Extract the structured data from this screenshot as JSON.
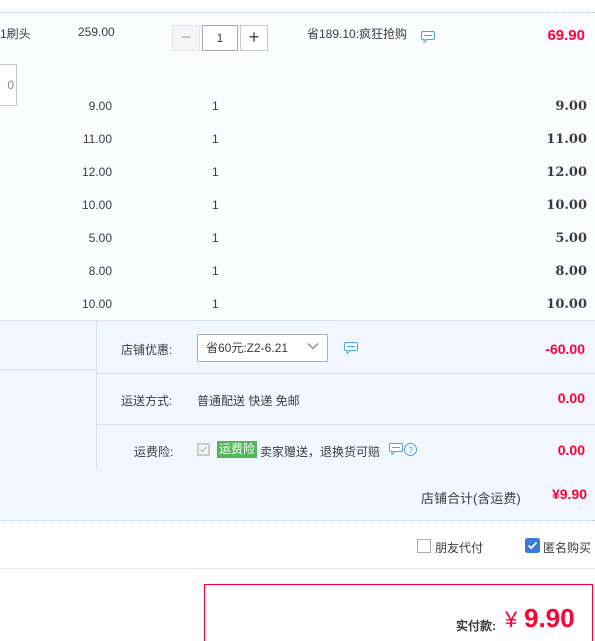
{
  "item": {
    "name": "1刷头",
    "price": "259.00",
    "qty_minus": "−",
    "qty": "1",
    "qty_plus": "+",
    "promo": "省189.10:疯狂抢购",
    "total": "69.90"
  },
  "rows": [
    {
      "price": "9.00",
      "qty": "1",
      "total": "9.00"
    },
    {
      "price": "11.00",
      "qty": "1",
      "total": "11.00"
    },
    {
      "price": "12.00",
      "qty": "1",
      "total": "12.00"
    },
    {
      "price": "10.00",
      "qty": "1",
      "total": "10.00"
    },
    {
      "price": "5.00",
      "qty": "1",
      "total": "5.00"
    },
    {
      "price": "8.00",
      "qty": "1",
      "total": "8.00"
    },
    {
      "price": "10.00",
      "qty": "1",
      "total": "10.00"
    }
  ],
  "shop": {
    "left_input_value": "0",
    "discount_label": "店铺优惠:",
    "discount_select": "省60元:Z2-6.21",
    "discount_value": "-60.00",
    "shipping_label": "运送方式:",
    "shipping_value_text": "普通配送 快递 免邮",
    "shipping_value": "0.00",
    "insurance_label": "运费险:",
    "insurance_tag": "运费险",
    "insurance_text": "卖家赠送，退换货可赔",
    "insurance_value": "0.00",
    "total_label": "店铺合计(含运费)",
    "total_value": "¥9.90"
  },
  "options": {
    "friend_pay": "朋友代付",
    "anonymous": "匿名购买"
  },
  "payment": {
    "label": "实付款:",
    "currency": "¥",
    "amount": "9.90"
  },
  "colors": {
    "accent_red": "#ff0036",
    "blue": "#3b7bd8",
    "green_tag": "#54b55b"
  }
}
